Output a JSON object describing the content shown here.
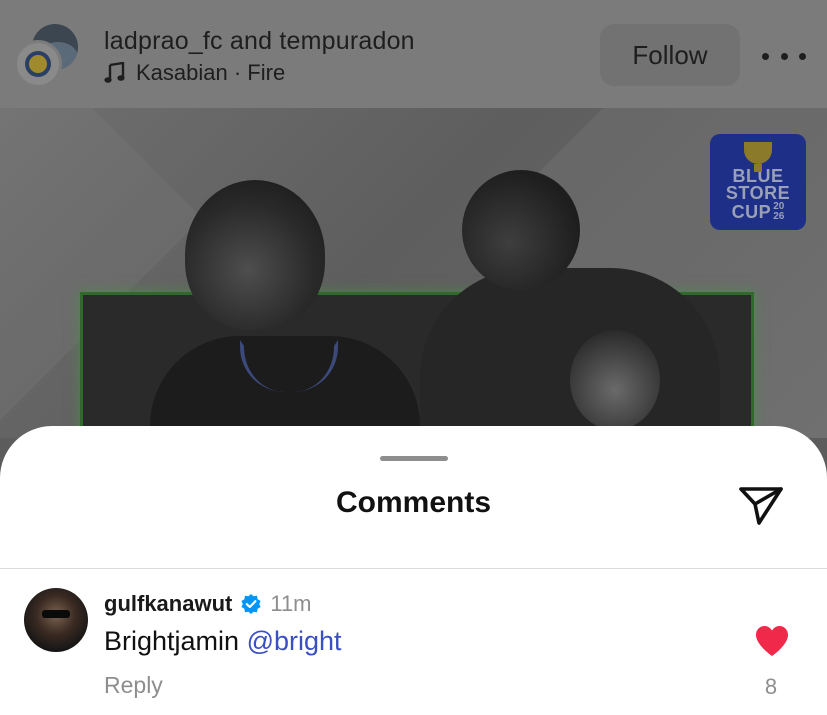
{
  "post": {
    "author_line": "ladprao_fc and tempuradon",
    "music": "Kasabian · Fire",
    "follow_label": "Follow",
    "badge": {
      "line1": "BLUE",
      "line2": "STORE",
      "line3": "CUP",
      "year_top": "20",
      "year_bottom": "26"
    }
  },
  "comments_sheet": {
    "title": "Comments",
    "comments": [
      {
        "username": "gulfkanawut",
        "verified": true,
        "time": "11m",
        "text": "Brightjamin ",
        "mention": "@bright",
        "reply_label": "Reply",
        "liked": true,
        "like_count": "8"
      }
    ]
  },
  "colors": {
    "like_red": "#f02849",
    "verified_blue": "#0095f6",
    "mention_blue": "#3b4fc4",
    "badge_blue": "#1d2f86"
  },
  "icons": {
    "music": "music-note-icon",
    "more": "more-horizontal-icon",
    "share": "send-icon",
    "verified": "verified-badge-icon",
    "like": "heart-filled-icon"
  }
}
